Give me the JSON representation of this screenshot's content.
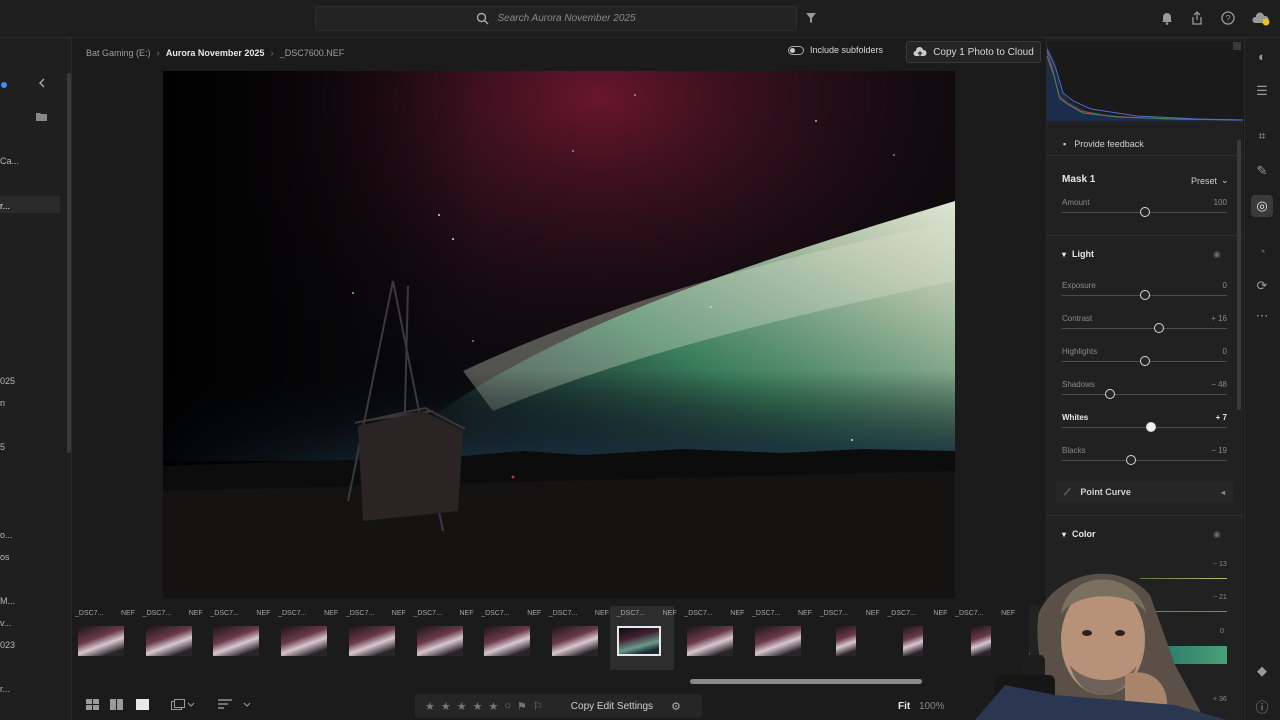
{
  "top_bar": {
    "search_placeholder": "Search Aurora November 2025"
  },
  "left_panel": {
    "items": [
      "Ca...",
      "r...",
      "025",
      "n",
      "5",
      "o...",
      "os",
      "M...",
      "v...",
      "023",
      "r..."
    ]
  },
  "breadcrumb": {
    "drive": "Bat Gaming  (E:)",
    "album": "Aurora November 2025",
    "file": "_DSC7600.NEF"
  },
  "include_subfolders": "Include subfolders",
  "copy_cloud": "Copy 1 Photo to Cloud",
  "filmstrip": {
    "name": "_DSC7...",
    "format": "NEF",
    "count_visible": 14,
    "selected_index": 8
  },
  "bottom_bar": {
    "copy_edit_settings": "Copy Edit Settings",
    "fit": "Fit",
    "zoom": "100%"
  },
  "right_panel": {
    "feedback": "Provide feedback",
    "mask_title": "Mask 1",
    "preset": "Preset",
    "amount": {
      "label": "Amount",
      "value": "100",
      "position": 0.5
    },
    "light_title": "Light",
    "sliders": [
      {
        "label": "Exposure",
        "value": "0",
        "position": 0.5
      },
      {
        "label": "Contrast",
        "value": "+ 16",
        "position": 0.59
      },
      {
        "label": "Highlights",
        "value": "0",
        "position": 0.5
      },
      {
        "label": "Shadows",
        "value": "− 48",
        "position": 0.29
      },
      {
        "label": "Whites",
        "value": "+ 7",
        "position": 0.54
      },
      {
        "label": "Blacks",
        "value": "− 19",
        "position": 0.42
      }
    ],
    "point_curve": "Point Curve",
    "color_title": "Color",
    "color_values": [
      "− 13",
      "− 21",
      "0",
      "+ 36"
    ]
  }
}
